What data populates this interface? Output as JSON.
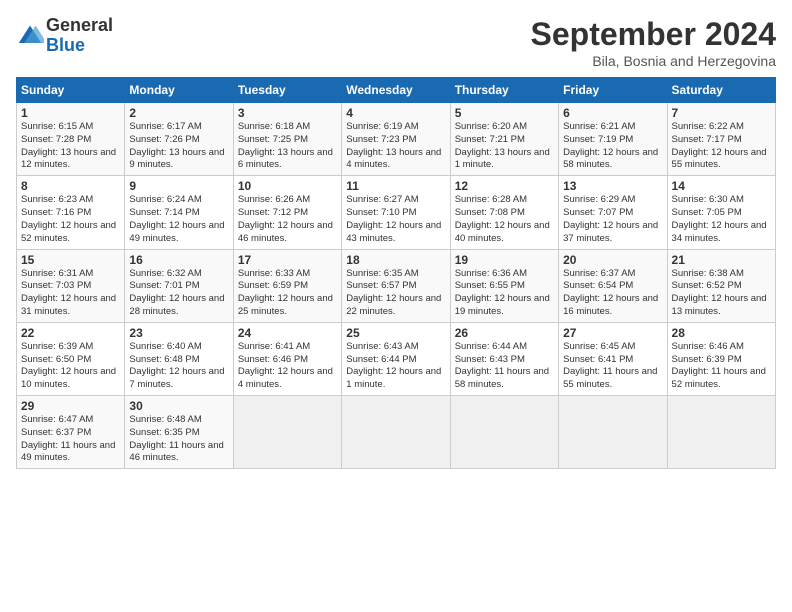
{
  "logo": {
    "general": "General",
    "blue": "Blue"
  },
  "header": {
    "month": "September 2024",
    "location": "Bila, Bosnia and Herzegovina"
  },
  "days_of_week": [
    "Sunday",
    "Monday",
    "Tuesday",
    "Wednesday",
    "Thursday",
    "Friday",
    "Saturday"
  ],
  "weeks": [
    [
      {
        "day": "1",
        "sunrise": "6:15 AM",
        "sunset": "7:28 PM",
        "daylight": "13 hours and 12 minutes."
      },
      {
        "day": "2",
        "sunrise": "6:17 AM",
        "sunset": "7:26 PM",
        "daylight": "13 hours and 9 minutes."
      },
      {
        "day": "3",
        "sunrise": "6:18 AM",
        "sunset": "7:25 PM",
        "daylight": "13 hours and 6 minutes."
      },
      {
        "day": "4",
        "sunrise": "6:19 AM",
        "sunset": "7:23 PM",
        "daylight": "13 hours and 4 minutes."
      },
      {
        "day": "5",
        "sunrise": "6:20 AM",
        "sunset": "7:21 PM",
        "daylight": "13 hours and 1 minute."
      },
      {
        "day": "6",
        "sunrise": "6:21 AM",
        "sunset": "7:19 PM",
        "daylight": "12 hours and 58 minutes."
      },
      {
        "day": "7",
        "sunrise": "6:22 AM",
        "sunset": "7:17 PM",
        "daylight": "12 hours and 55 minutes."
      }
    ],
    [
      {
        "day": "8",
        "sunrise": "6:23 AM",
        "sunset": "7:16 PM",
        "daylight": "12 hours and 52 minutes."
      },
      {
        "day": "9",
        "sunrise": "6:24 AM",
        "sunset": "7:14 PM",
        "daylight": "12 hours and 49 minutes."
      },
      {
        "day": "10",
        "sunrise": "6:26 AM",
        "sunset": "7:12 PM",
        "daylight": "12 hours and 46 minutes."
      },
      {
        "day": "11",
        "sunrise": "6:27 AM",
        "sunset": "7:10 PM",
        "daylight": "12 hours and 43 minutes."
      },
      {
        "day": "12",
        "sunrise": "6:28 AM",
        "sunset": "7:08 PM",
        "daylight": "12 hours and 40 minutes."
      },
      {
        "day": "13",
        "sunrise": "6:29 AM",
        "sunset": "7:07 PM",
        "daylight": "12 hours and 37 minutes."
      },
      {
        "day": "14",
        "sunrise": "6:30 AM",
        "sunset": "7:05 PM",
        "daylight": "12 hours and 34 minutes."
      }
    ],
    [
      {
        "day": "15",
        "sunrise": "6:31 AM",
        "sunset": "7:03 PM",
        "daylight": "12 hours and 31 minutes."
      },
      {
        "day": "16",
        "sunrise": "6:32 AM",
        "sunset": "7:01 PM",
        "daylight": "12 hours and 28 minutes."
      },
      {
        "day": "17",
        "sunrise": "6:33 AM",
        "sunset": "6:59 PM",
        "daylight": "12 hours and 25 minutes."
      },
      {
        "day": "18",
        "sunrise": "6:35 AM",
        "sunset": "6:57 PM",
        "daylight": "12 hours and 22 minutes."
      },
      {
        "day": "19",
        "sunrise": "6:36 AM",
        "sunset": "6:55 PM",
        "daylight": "12 hours and 19 minutes."
      },
      {
        "day": "20",
        "sunrise": "6:37 AM",
        "sunset": "6:54 PM",
        "daylight": "12 hours and 16 minutes."
      },
      {
        "day": "21",
        "sunrise": "6:38 AM",
        "sunset": "6:52 PM",
        "daylight": "12 hours and 13 minutes."
      }
    ],
    [
      {
        "day": "22",
        "sunrise": "6:39 AM",
        "sunset": "6:50 PM",
        "daylight": "12 hours and 10 minutes."
      },
      {
        "day": "23",
        "sunrise": "6:40 AM",
        "sunset": "6:48 PM",
        "daylight": "12 hours and 7 minutes."
      },
      {
        "day": "24",
        "sunrise": "6:41 AM",
        "sunset": "6:46 PM",
        "daylight": "12 hours and 4 minutes."
      },
      {
        "day": "25",
        "sunrise": "6:43 AM",
        "sunset": "6:44 PM",
        "daylight": "12 hours and 1 minute."
      },
      {
        "day": "26",
        "sunrise": "6:44 AM",
        "sunset": "6:43 PM",
        "daylight": "11 hours and 58 minutes."
      },
      {
        "day": "27",
        "sunrise": "6:45 AM",
        "sunset": "6:41 PM",
        "daylight": "11 hours and 55 minutes."
      },
      {
        "day": "28",
        "sunrise": "6:46 AM",
        "sunset": "6:39 PM",
        "daylight": "11 hours and 52 minutes."
      }
    ],
    [
      {
        "day": "29",
        "sunrise": "6:47 AM",
        "sunset": "6:37 PM",
        "daylight": "11 hours and 49 minutes."
      },
      {
        "day": "30",
        "sunrise": "6:48 AM",
        "sunset": "6:35 PM",
        "daylight": "11 hours and 46 minutes."
      },
      null,
      null,
      null,
      null,
      null
    ]
  ]
}
